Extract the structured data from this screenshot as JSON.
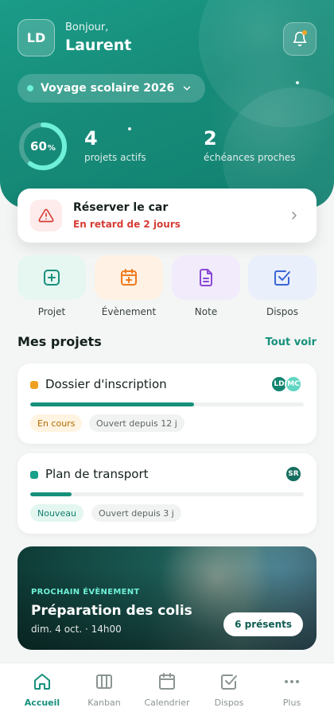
{
  "header": {
    "avatar_initials": "LD",
    "greeting": "Bonjour,",
    "user_name": "Laurent",
    "trip_selector": "Voyage scolaire 2026",
    "progress_percent": 60,
    "progress_value": "60",
    "progress_unit": "%",
    "stats": [
      {
        "value": "4",
        "label": "projets actifs"
      },
      {
        "value": "2",
        "label": "échéances proches"
      }
    ]
  },
  "alert": {
    "title": "Réserver le car",
    "subtitle": "En retard de 2 jours"
  },
  "quick_actions": [
    {
      "label": "Projet",
      "icon": "plus-square-icon",
      "bg": "#e6f6f1",
      "color": "#17907c"
    },
    {
      "label": "Évènement",
      "icon": "calendar-plus-icon",
      "bg": "#fff1e3",
      "color": "#ef7a1e"
    },
    {
      "label": "Note",
      "icon": "document-icon",
      "bg": "#f1ebfb",
      "color": "#8b47d6"
    },
    {
      "label": "Dispos",
      "icon": "checkbox-icon",
      "bg": "#e9effb",
      "color": "#3a66d4"
    }
  ],
  "projects_section": {
    "title": "Mes projets",
    "see_all": "Tout voir"
  },
  "projects": [
    {
      "title": "Dossier d'inscription",
      "status_color": "#f0a020",
      "progress": 0.6,
      "status": "En cours",
      "status_chip_bg": "#fff4e1",
      "status_chip_color": "#b36b00",
      "opened": "Ouvert depuis 12 j",
      "members": [
        {
          "initials": "LD",
          "color": "#138571"
        },
        {
          "initials": "MC",
          "color": "#5fd6c2"
        }
      ]
    },
    {
      "title": "Plan de transport",
      "status_color": "#17a08a",
      "progress": 0.15,
      "status": "Nouveau",
      "status_chip_bg": "#e3f6f0",
      "status_chip_color": "#13806d",
      "opened": "Ouvert depuis 3 j",
      "members": [
        {
          "initials": "SR",
          "color": "#156e60"
        }
      ]
    }
  ],
  "next_event": {
    "kicker": "PROCHAIN ÉVÈNEMENT",
    "title": "Préparation des colis",
    "date": "dim. 4 oct. · 14h00",
    "attendees": "6 présents"
  },
  "tabbar": [
    {
      "label": "Accueil",
      "icon": "home-icon",
      "active": true
    },
    {
      "label": "Kanban",
      "icon": "kanban-icon",
      "active": false
    },
    {
      "label": "Calendrier",
      "icon": "calendar-icon",
      "active": false
    },
    {
      "label": "Dispos",
      "icon": "checkbox-icon",
      "active": false
    },
    {
      "label": "Plus",
      "icon": "more-icon",
      "active": false
    }
  ],
  "colors": {
    "brand": "#17907c",
    "danger": "#d63d36"
  }
}
